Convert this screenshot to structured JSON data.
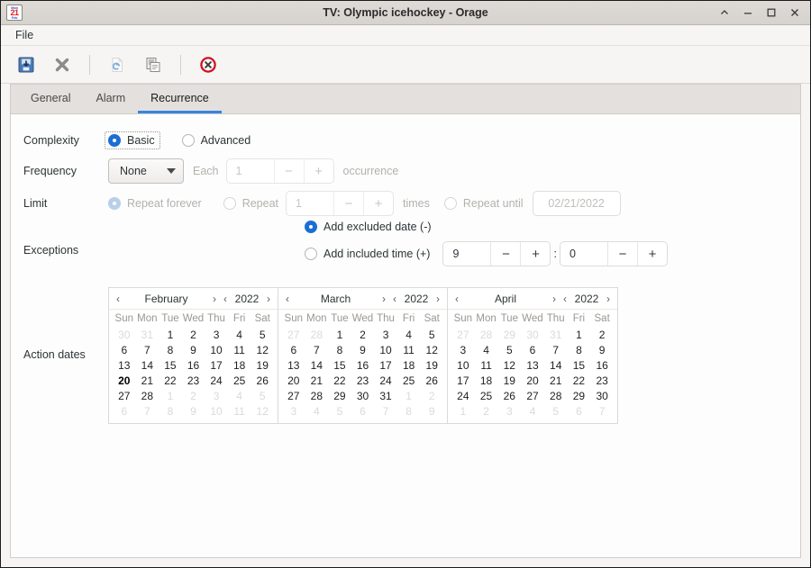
{
  "window": {
    "title": "TV: Olympic icehockey - Orage",
    "icon": {
      "name": "calendar-icon",
      "top": "Mon",
      "day": "21",
      "month": "Feb"
    },
    "controls": [
      {
        "name": "shade-button",
        "glyph": "^"
      },
      {
        "name": "minimize-button",
        "glyph": "—"
      },
      {
        "name": "maximize-button",
        "glyph": "□"
      },
      {
        "name": "close-button",
        "glyph": "✕"
      }
    ]
  },
  "menubar": {
    "items": [
      {
        "label": "File"
      }
    ]
  },
  "toolbar": {
    "buttons": [
      {
        "name": "save-button",
        "icon": "save-icon",
        "enabled": true
      },
      {
        "name": "delete-button",
        "icon": "delete-x-icon",
        "enabled": true
      },
      {
        "name": "revert-button",
        "icon": "revert-icon",
        "enabled": false
      },
      {
        "name": "duplicate-button",
        "icon": "duplicate-icon",
        "enabled": true
      },
      {
        "name": "close-window-button",
        "icon": "close-circle-icon",
        "enabled": true
      }
    ]
  },
  "tabs": [
    {
      "label": "General",
      "active": false
    },
    {
      "label": "Alarm",
      "active": false
    },
    {
      "label": "Recurrence",
      "active": true
    }
  ],
  "accent_color": "#3584e4",
  "form": {
    "complexity": {
      "label": "Complexity",
      "options": [
        {
          "label": "Basic",
          "selected": true,
          "focused": true
        },
        {
          "label": "Advanced",
          "selected": false,
          "focused": false
        }
      ]
    },
    "frequency": {
      "label": "Frequency",
      "value": "None",
      "each_label": "Each",
      "each_value": "1",
      "minus": "−",
      "plus": "+",
      "unit_label": "occurrence",
      "disabled": true
    },
    "limit": {
      "label": "Limit",
      "repeat_forever": {
        "label": "Repeat forever",
        "selected": true
      },
      "repeat": {
        "label": "Repeat",
        "selected": false,
        "value": "1",
        "times_label": "times",
        "minus": "−",
        "plus": "+"
      },
      "repeat_until": {
        "label": "Repeat until",
        "selected": false,
        "date": "02/21/2022"
      }
    },
    "exceptions": {
      "label": "Exceptions",
      "excluded": {
        "label": "Add excluded date (-)",
        "selected": true
      },
      "included": {
        "label": "Add included time (+)",
        "selected": false
      },
      "hour": {
        "value": "9",
        "minus": "−",
        "plus": "+"
      },
      "separator": ":",
      "minute": {
        "value": "0",
        "minus": "−",
        "plus": "+"
      }
    },
    "action_dates": {
      "label": "Action dates",
      "prev_arrow": "‹",
      "next_arrow": "›",
      "dow": [
        "Sun",
        "Mon",
        "Tue",
        "Wed",
        "Thu",
        "Fri",
        "Sat"
      ],
      "calendars": [
        {
          "month": "February",
          "year": "2022",
          "weeks": [
            [
              {
                "d": "30",
                "o": true
              },
              {
                "d": "31",
                "o": true
              },
              {
                "d": "1"
              },
              {
                "d": "2"
              },
              {
                "d": "3"
              },
              {
                "d": "4"
              },
              {
                "d": "5"
              }
            ],
            [
              {
                "d": "6"
              },
              {
                "d": "7"
              },
              {
                "d": "8"
              },
              {
                "d": "9"
              },
              {
                "d": "10"
              },
              {
                "d": "11"
              },
              {
                "d": "12"
              }
            ],
            [
              {
                "d": "13"
              },
              {
                "d": "14"
              },
              {
                "d": "15"
              },
              {
                "d": "16"
              },
              {
                "d": "17"
              },
              {
                "d": "18"
              },
              {
                "d": "19"
              }
            ],
            [
              {
                "d": "20",
                "s": true
              },
              {
                "d": "21"
              },
              {
                "d": "22"
              },
              {
                "d": "23"
              },
              {
                "d": "24"
              },
              {
                "d": "25"
              },
              {
                "d": "26"
              }
            ],
            [
              {
                "d": "27"
              },
              {
                "d": "28"
              },
              {
                "d": "1",
                "o": true
              },
              {
                "d": "2",
                "o": true
              },
              {
                "d": "3",
                "o": true
              },
              {
                "d": "4",
                "o": true
              },
              {
                "d": "5",
                "o": true
              }
            ],
            [
              {
                "d": "6",
                "o": true
              },
              {
                "d": "7",
                "o": true
              },
              {
                "d": "8",
                "o": true
              },
              {
                "d": "9",
                "o": true
              },
              {
                "d": "10",
                "o": true
              },
              {
                "d": "11",
                "o": true
              },
              {
                "d": "12",
                "o": true
              }
            ]
          ]
        },
        {
          "month": "March",
          "year": "2022",
          "weeks": [
            [
              {
                "d": "27",
                "o": true
              },
              {
                "d": "28",
                "o": true
              },
              {
                "d": "1"
              },
              {
                "d": "2"
              },
              {
                "d": "3"
              },
              {
                "d": "4"
              },
              {
                "d": "5"
              }
            ],
            [
              {
                "d": "6"
              },
              {
                "d": "7"
              },
              {
                "d": "8"
              },
              {
                "d": "9"
              },
              {
                "d": "10"
              },
              {
                "d": "11"
              },
              {
                "d": "12"
              }
            ],
            [
              {
                "d": "13"
              },
              {
                "d": "14"
              },
              {
                "d": "15"
              },
              {
                "d": "16"
              },
              {
                "d": "17"
              },
              {
                "d": "18"
              },
              {
                "d": "19"
              }
            ],
            [
              {
                "d": "20"
              },
              {
                "d": "21"
              },
              {
                "d": "22"
              },
              {
                "d": "23"
              },
              {
                "d": "24"
              },
              {
                "d": "25"
              },
              {
                "d": "26"
              }
            ],
            [
              {
                "d": "27"
              },
              {
                "d": "28"
              },
              {
                "d": "29"
              },
              {
                "d": "30"
              },
              {
                "d": "31"
              },
              {
                "d": "1",
                "o": true
              },
              {
                "d": "2",
                "o": true
              }
            ],
            [
              {
                "d": "3",
                "o": true
              },
              {
                "d": "4",
                "o": true
              },
              {
                "d": "5",
                "o": true
              },
              {
                "d": "6",
                "o": true
              },
              {
                "d": "7",
                "o": true
              },
              {
                "d": "8",
                "o": true
              },
              {
                "d": "9",
                "o": true
              }
            ]
          ]
        },
        {
          "month": "April",
          "year": "2022",
          "weeks": [
            [
              {
                "d": "27",
                "o": true
              },
              {
                "d": "28",
                "o": true
              },
              {
                "d": "29",
                "o": true
              },
              {
                "d": "30",
                "o": true
              },
              {
                "d": "31",
                "o": true
              },
              {
                "d": "1"
              },
              {
                "d": "2"
              }
            ],
            [
              {
                "d": "3"
              },
              {
                "d": "4"
              },
              {
                "d": "5"
              },
              {
                "d": "6"
              },
              {
                "d": "7"
              },
              {
                "d": "8"
              },
              {
                "d": "9"
              }
            ],
            [
              {
                "d": "10"
              },
              {
                "d": "11"
              },
              {
                "d": "12"
              },
              {
                "d": "13"
              },
              {
                "d": "14"
              },
              {
                "d": "15"
              },
              {
                "d": "16"
              }
            ],
            [
              {
                "d": "17"
              },
              {
                "d": "18"
              },
              {
                "d": "19"
              },
              {
                "d": "20"
              },
              {
                "d": "21"
              },
              {
                "d": "22"
              },
              {
                "d": "23"
              }
            ],
            [
              {
                "d": "24"
              },
              {
                "d": "25"
              },
              {
                "d": "26"
              },
              {
                "d": "27"
              },
              {
                "d": "28"
              },
              {
                "d": "29"
              },
              {
                "d": "30"
              }
            ],
            [
              {
                "d": "1",
                "o": true
              },
              {
                "d": "2",
                "o": true
              },
              {
                "d": "3",
                "o": true
              },
              {
                "d": "4",
                "o": true
              },
              {
                "d": "5",
                "o": true
              },
              {
                "d": "6",
                "o": true
              },
              {
                "d": "7",
                "o": true
              }
            ]
          ]
        }
      ]
    }
  }
}
